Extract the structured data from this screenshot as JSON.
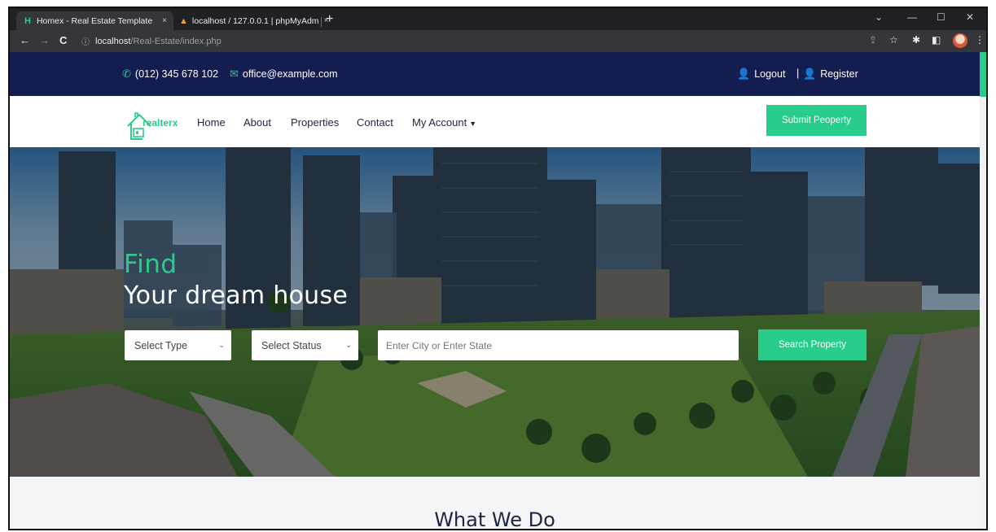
{
  "browser": {
    "tabs": [
      {
        "favicon": "H",
        "title": "Homex - Real Estate Template",
        "close": "×"
      },
      {
        "favicon": "▲",
        "title": "localhost / 127.0.0.1 | phpMyAdm",
        "close": "×"
      }
    ],
    "new_tab": "+",
    "url_host": "localhost",
    "url_path": "/Real-Estate/index.php",
    "back": "←",
    "forward": "→",
    "reload": "C",
    "info_icon": "ⓘ",
    "window_controls": {
      "chevron": "⌄",
      "minimize": "—",
      "maximize": "☐",
      "close": "✕"
    },
    "right_icons": {
      "share": "⇪",
      "star": "☆",
      "extensions": "✱",
      "sidebar": "◧",
      "menu": "⋮"
    }
  },
  "infobar": {
    "phone": "(012) 345 678 102",
    "email": "office@example.com",
    "logout": "Logout",
    "separator": "|",
    "register": "Register",
    "phone_icon": "phone-icon",
    "email_icon": "mail-icon",
    "user_icon": "user-icon"
  },
  "navbar": {
    "logo_text": "realterx",
    "links": [
      "Home",
      "About",
      "Properties",
      "Contact",
      "My Account"
    ],
    "account_caret": "▼",
    "submit_label": "Submit Peoperty"
  },
  "hero": {
    "find": "Find",
    "title": "Your dream house",
    "type_select": "Select Type",
    "status_select": "Select Status",
    "city_placeholder": "Enter City or Enter State",
    "search_label": "Search Property",
    "chevron": "⌄"
  },
  "section": {
    "title": "What We Do"
  },
  "colors": {
    "accent": "#28cc8b",
    "navy": "#141d4f"
  }
}
